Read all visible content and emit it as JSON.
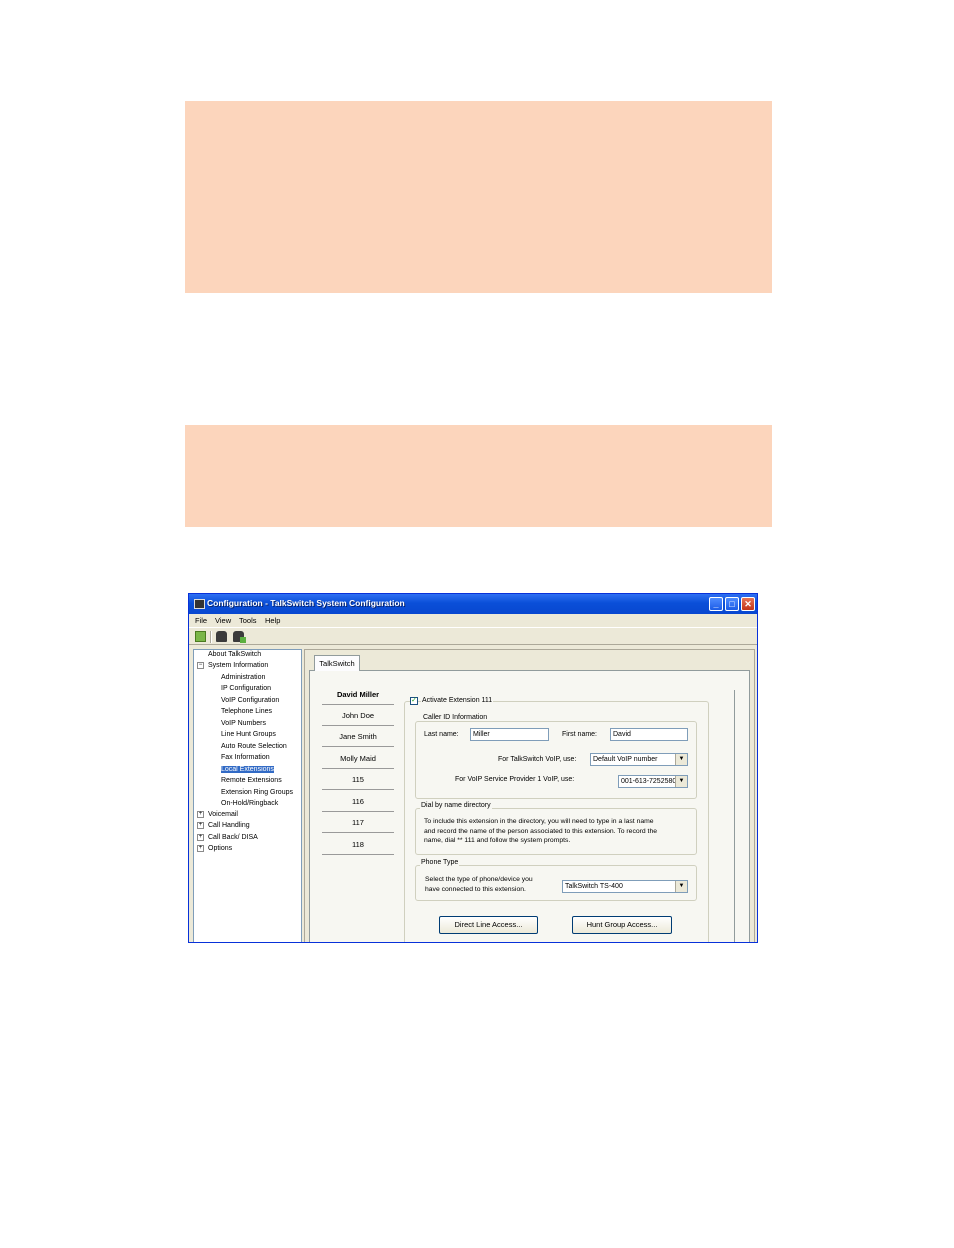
{
  "window": {
    "title": "Configuration - TalkSwitch System Configuration",
    "minimize": "_",
    "maximize": "□",
    "close": "✕"
  },
  "menu": {
    "items": [
      "File",
      "View",
      "Tools",
      "Help"
    ]
  },
  "toolbar": {
    "icons": [
      "user-icon",
      "phone-icon",
      "phone-add-icon"
    ]
  },
  "tree": {
    "expand_collapsed": "+",
    "expand_open": "−",
    "items": [
      "About TalkSwitch",
      "System Information",
      "Administration",
      "IP Configuration",
      "VoIP Configuration",
      "Telephone Lines",
      "VoIP Numbers",
      "Line Hunt Groups",
      "Auto Route Selection",
      "Fax Information",
      "Local Extensions",
      "Remote Extensions",
      "Extension Ring Groups",
      "On-Hold/Ringback",
      "Voicemail",
      "Call Handling",
      "Call Back/ DISA",
      "Options"
    ],
    "selected": "Local Extensions"
  },
  "tab": {
    "label": "TalkSwitch"
  },
  "extensions": [
    "David Miller",
    "John Doe",
    "Jane Smith",
    "Molly Maid",
    "115",
    "116",
    "117",
    "118"
  ],
  "activate": {
    "checked": "✓",
    "label": "Activate Extension 111"
  },
  "caller_id": {
    "group_label": "Caller ID Information",
    "last_name_label": "Last name:",
    "last_name_value": "Miller",
    "first_name_label": "First name:",
    "first_name_value": "David",
    "talkswitch_voip_label": "For TalkSwitch VoIP, use:",
    "talkswitch_voip_value": "Default VoIP number",
    "provider_label": "For VoIP Service Provider 1 VoIP, use:",
    "provider_value": "001-613-7252580"
  },
  "dial_by_name": {
    "group_label": "Dial by name directory",
    "line1": "To include this extension in the directory, you will need to type in a last name",
    "line2": "and record the name of the person associated to this extension. To record the",
    "line3": "name, dial ** 111 and follow the system prompts."
  },
  "phone_type": {
    "group_label": "Phone Type",
    "line1": "Select the type of phone/device you",
    "line2": "have connected to  this extension.",
    "value": "TalkSwitch TS-400"
  },
  "buttons": {
    "direct_line": "Direct Line Access...",
    "hunt_group": "Hunt Group Access..."
  }
}
